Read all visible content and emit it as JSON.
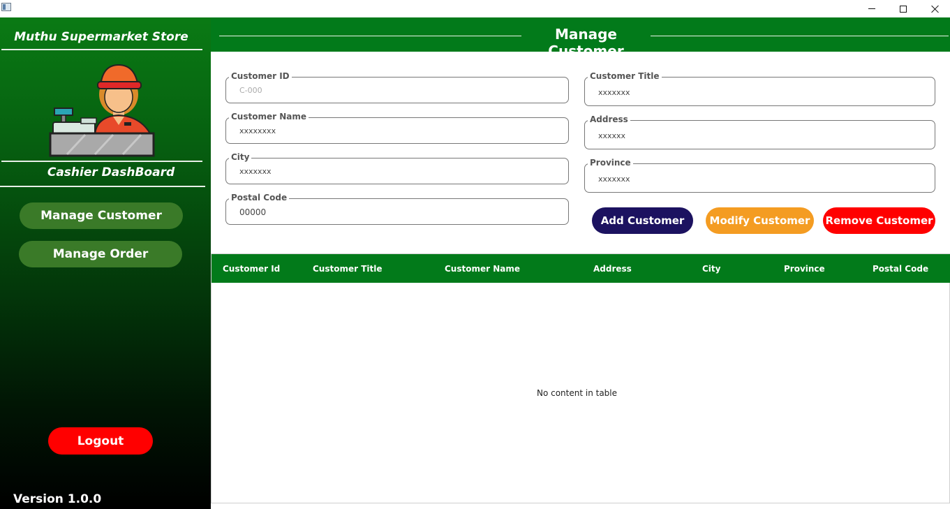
{
  "window": {
    "controls": {
      "minimize": "minimize-icon",
      "maximize": "maximize-icon",
      "close": "close-icon"
    }
  },
  "sidebar": {
    "store_name": "Muthu Supermarket Store",
    "dashboard_title": "Cashier DashBoard",
    "nav": [
      {
        "label": "Manage Customer"
      },
      {
        "label": "Manage Order"
      }
    ],
    "logout_label": "Logout",
    "version": "Version 1.0.0"
  },
  "header": {
    "title": "Manage Customer"
  },
  "form": {
    "customer_id": {
      "label": "Customer ID",
      "value": "",
      "placeholder": "C-000"
    },
    "customer_name": {
      "label": "Customer Name",
      "value": "",
      "placeholder": "xxxxxxxx"
    },
    "city": {
      "label": "City",
      "value": "",
      "placeholder": "xxxxxxx"
    },
    "postal_code": {
      "label": "Postal Code",
      "value": "",
      "placeholder": "00000"
    },
    "customer_title": {
      "label": "Customer Title",
      "value": "",
      "placeholder": "xxxxxxx"
    },
    "address": {
      "label": "Address",
      "value": "",
      "placeholder": "xxxxxx"
    },
    "province": {
      "label": "Province",
      "value": "",
      "placeholder": "xxxxxxx"
    }
  },
  "actions": {
    "add": "Add Customer",
    "modify": "Modify Customer",
    "remove": "Remove Customer"
  },
  "table": {
    "columns": [
      "Customer Id",
      "Customer Title",
      "Customer Name",
      "Address",
      "City",
      "Province",
      "Postal Code"
    ],
    "rows": [],
    "empty_message": "No content in table"
  },
  "colors": {
    "header_green": "#027a1a",
    "nav_button": "#3a7a28",
    "add_button": "#1c1260",
    "modify_button": "#f49c22",
    "remove_button": "#ff0000"
  }
}
